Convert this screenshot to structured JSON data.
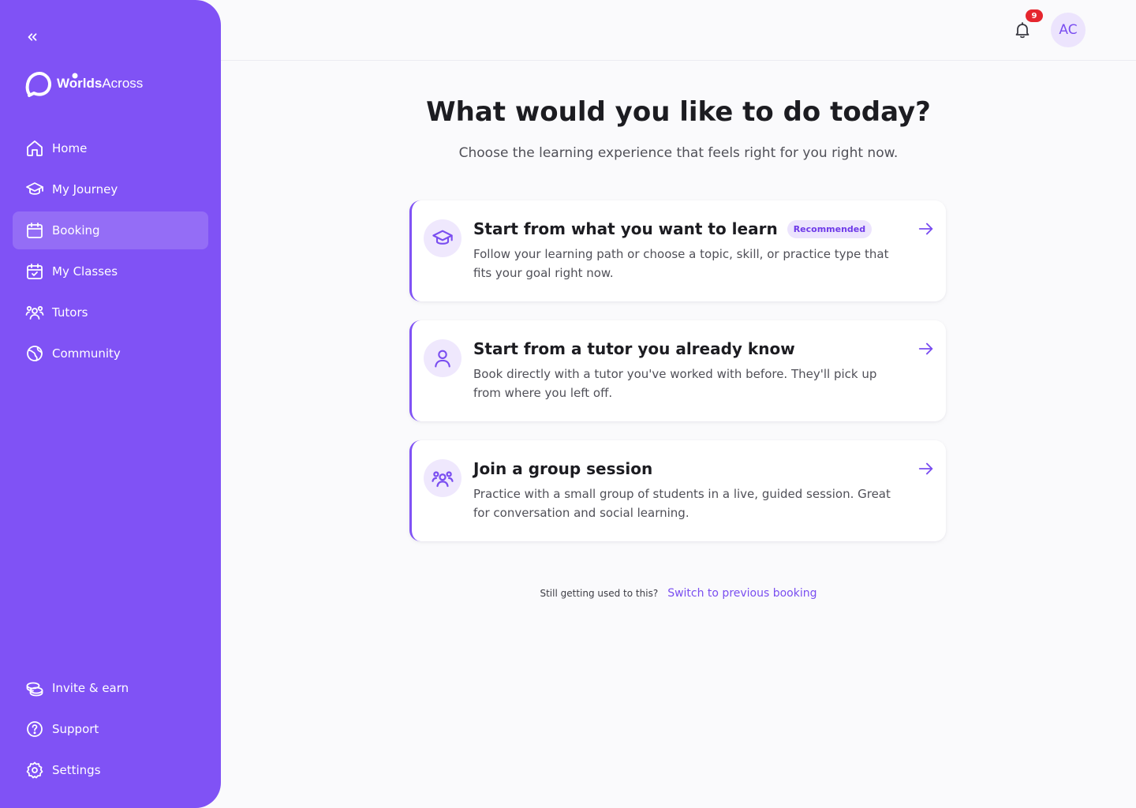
{
  "brand": {
    "prefix": "Worlds",
    "suffix": "Across"
  },
  "sidebar": {
    "items": [
      {
        "label": "Home",
        "icon": "home-icon"
      },
      {
        "label": "My Journey",
        "icon": "graduation-cap-icon"
      },
      {
        "label": "Booking",
        "icon": "calendar-icon",
        "active": true
      },
      {
        "label": "My Classes",
        "icon": "calendar-check-icon"
      },
      {
        "label": "Tutors",
        "icon": "users-icon"
      },
      {
        "label": "Community",
        "icon": "globe-icon"
      }
    ],
    "bottom_items": [
      {
        "label": "Invite & earn",
        "icon": "coins-icon"
      },
      {
        "label": "Support",
        "icon": "help-circle-icon"
      },
      {
        "label": "Settings",
        "icon": "gear-icon"
      }
    ]
  },
  "header": {
    "notification_count": "9",
    "avatar_initials": "AC"
  },
  "main": {
    "title": "What would you like to do today?",
    "subtitle": "Choose the learning experience that feels right for you right now.",
    "options": [
      {
        "title": "Start from what you want to learn",
        "badge": "Recommended",
        "description": "Follow your learning path or choose a topic, skill, or practice type that fits your goal right now.",
        "icon": "graduation-cap-icon"
      },
      {
        "title": "Start from a tutor you already know",
        "description": "Book directly with a tutor you've worked with before. They'll pick up from where you left off.",
        "icon": "user-icon"
      },
      {
        "title": "Join a group session",
        "description": "Practice with a small group of students in a live, guided session. Great for conversation and social learning.",
        "icon": "users-icon"
      }
    ],
    "footer_note": "Still getting used to this?",
    "footer_link": "Switch to previous booking"
  },
  "colors": {
    "brand_purple": "#8052f5",
    "accent_purple": "#7a4ef0",
    "badge_red": "#e5262e"
  }
}
